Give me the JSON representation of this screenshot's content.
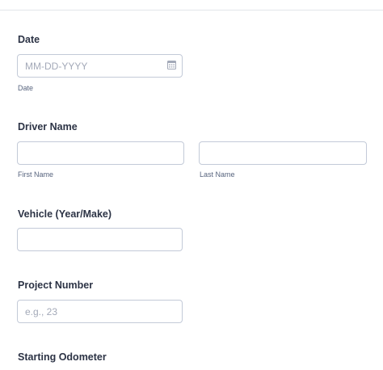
{
  "fields": {
    "date": {
      "label": "Date",
      "placeholder": "MM-DD-YYYY",
      "value": "",
      "sublabel": "Date",
      "icon": "calendar-icon"
    },
    "driver_name": {
      "label": "Driver Name",
      "first": {
        "value": "",
        "sublabel": "First Name"
      },
      "last": {
        "value": "",
        "sublabel": "Last Name"
      }
    },
    "vehicle": {
      "label": "Vehicle (Year/Make)",
      "value": ""
    },
    "project_number": {
      "label": "Project Number",
      "placeholder": "e.g., 23",
      "value": ""
    },
    "starting_odometer": {
      "label": "Starting Odometer"
    }
  },
  "colors": {
    "text": "#2c3345",
    "sublabel": "#57647e",
    "input_border": "#c3cad8",
    "placeholder": "#a3a9b8",
    "divider": "#e3e5ea"
  }
}
